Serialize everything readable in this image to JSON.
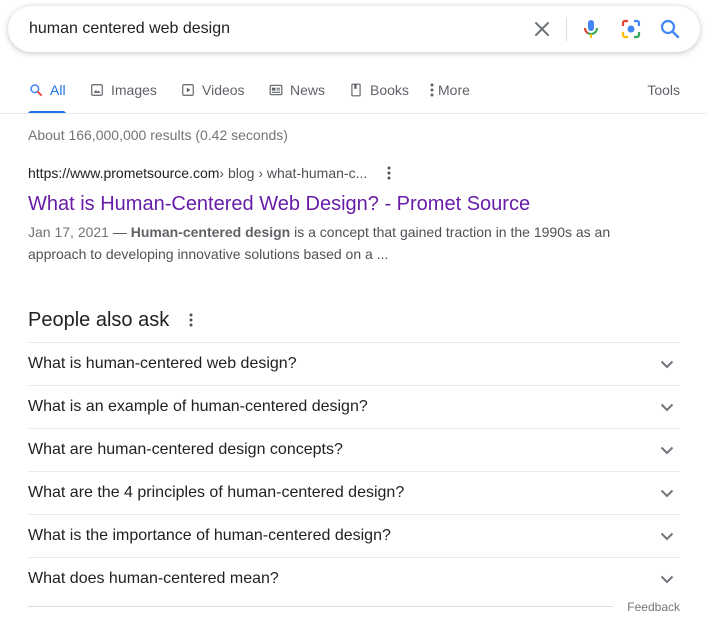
{
  "search": {
    "query": "human centered web design",
    "icons": {
      "clear": "close-icon",
      "voice": "mic-icon",
      "lens": "camera-lens-icon",
      "submit": "search-icon"
    },
    "colors": {
      "blue": "#4285f4",
      "red": "#ea4335",
      "yellow": "#fbbc04",
      "green": "#34a853"
    }
  },
  "tabs": [
    {
      "label": "All",
      "icon": "search-icon",
      "active": true
    },
    {
      "label": "Images",
      "icon": "image-icon"
    },
    {
      "label": "Videos",
      "icon": "play-icon"
    },
    {
      "label": "News",
      "icon": "news-icon"
    },
    {
      "label": "Books",
      "icon": "book-icon"
    },
    {
      "label": "More",
      "icon": "dots-vertical-icon"
    }
  ],
  "tools_label": "Tools",
  "stats": "About 166,000,000 results (0.42 seconds)",
  "result": {
    "cite_host": "https://www.prometsource.com",
    "cite_path": " › blog › what-human-c...",
    "title": "What is Human-Centered Web Design? - Promet Source",
    "date": "Jan 17, 2021",
    "date_sep": " — ",
    "snippet_bold": "Human-centered design",
    "snippet_rest": " is a concept that gained traction in the 1990s as an approach to developing innovative solutions based on a ...",
    "title_color": "#681da8"
  },
  "paa": {
    "title": "People also ask",
    "questions": [
      "What is human-centered web design?",
      "What is an example of human-centered design?",
      "What are human-centered design concepts?",
      "What are the 4 principles of human-centered design?",
      "What is the importance of human-centered design?",
      "What does human-centered mean?"
    ]
  },
  "feedback": "Feedback",
  "accent": "#1a73e8"
}
